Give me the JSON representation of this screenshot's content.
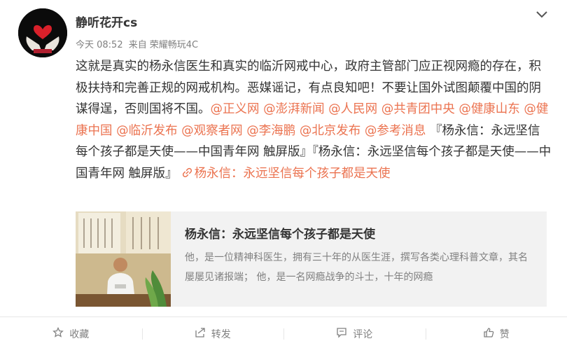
{
  "post": {
    "author": "静听花开cs",
    "time": "今天 08:52",
    "source_prefix": "来自",
    "source": "荣耀畅玩4C",
    "text_main": "这就是真实的杨永信医生和真实的临沂网戒中心，政府主管部门应正视网瘾的存在，积极扶持和完善正规的网戒机构。恶媒谣记，有点良知吧！不要让国外试图颠覆中国的阴谋得逞，否则国将不国。",
    "mentions": [
      "@正义网",
      "@澎湃新闻",
      "@人民网",
      "@共青团中央",
      "@健康山东",
      "@健康中国",
      "@临沂发布",
      "@观察者网",
      "@李海鹏",
      "@北京发布",
      "@参考消息"
    ],
    "shared_links": [
      "『杨永信：永远坚信每个孩子都是天使——中国青年网 触屏版』",
      "『杨永信：永远坚信每个孩子都是天使——中国青年网 触屏版』"
    ],
    "link_label": "杨永信：永远坚信每个孩子都是天使"
  },
  "card": {
    "title": "杨永信：永远坚信每个孩子都是天使",
    "description": "他，是一位精神科医生，拥有三十年的从医生涯，撰写各类心理科普文章，其名屡屡见诸报端； 他，是一名网瘾战争的斗士，十年的网瘾"
  },
  "actions": {
    "favorite": "收藏",
    "repost": "转发",
    "comment": "评论",
    "like": "赞"
  },
  "colors": {
    "link": "#eb7350",
    "text": "#333333",
    "meta": "#808080",
    "card_bg": "#f2f2f2"
  },
  "icons": [
    "avatar-hands-heart-icon",
    "chevron-down-icon",
    "link-icon",
    "star-icon",
    "repost-icon",
    "comment-icon",
    "thumbs-up-icon"
  ]
}
